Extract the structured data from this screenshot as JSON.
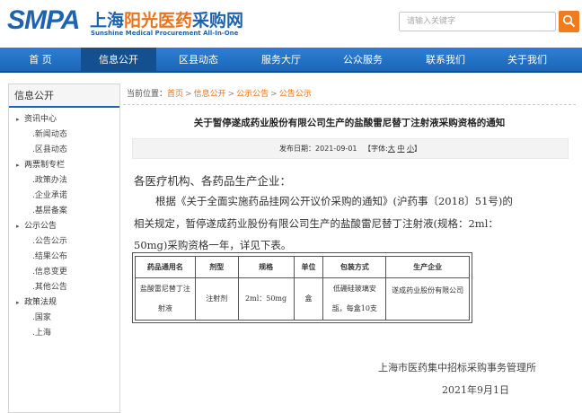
{
  "header": {
    "logo_smpa": "SMPA",
    "logo_cn_a": "上海",
    "logo_cn_b": "阳光医药",
    "logo_cn_c": "采购网",
    "logo_en": "Sunshine Medical Procurement All-In-One",
    "search_placeholder": "请输入关键字"
  },
  "nav": [
    {
      "label": "首 页",
      "active": false
    },
    {
      "label": "信息公开",
      "active": true
    },
    {
      "label": "区县动态",
      "active": false
    },
    {
      "label": "服务大厅",
      "active": false
    },
    {
      "label": "公众服务",
      "active": false
    },
    {
      "label": "联系我们",
      "active": false
    },
    {
      "label": "关于我们",
      "active": false
    }
  ],
  "sidebar": {
    "title": "信息公开",
    "groups": [
      {
        "label": "资讯中心",
        "items": [
          "新闻动态",
          "区县动态"
        ]
      },
      {
        "label": "两票制专栏",
        "items": [
          "政策办法",
          "企业承诺",
          "基层备案"
        ]
      },
      {
        "label": "公示公告",
        "items": [
          "公告公示",
          "结果公布",
          "信息变更",
          "其他公告"
        ]
      },
      {
        "label": "政策法规",
        "items": [
          "国家",
          "上海"
        ]
      }
    ]
  },
  "breadcrumb": {
    "prefix": "当前位置：",
    "items": [
      "首页",
      "信息公开",
      "公示公告",
      "公告公示"
    ],
    "sep": ">"
  },
  "article": {
    "title": "关于暂停遂成药业股份有限公司生产的盐酸雷尼替丁注射液采购资格的通知",
    "meta_date": "发布日期：2021-09-01",
    "meta_font_prefix": "【字体:",
    "meta_font_sizes": [
      "大",
      "中",
      "小"
    ],
    "meta_font_suffix": "】",
    "salutation": "各医疗机构、各药品生产企业：",
    "para_line1": "根据《关于全面实施药品挂网公开议价采购的通知》(沪药事〔2018〕51号)的",
    "para_line2": "相关规定，暂停遂成药业股份有限公司生产的盐酸雷尼替丁注射液(规格：2ml：",
    "para_line3": "50mg)采购资格一年，详见下表。",
    "table": {
      "headers": [
        "药品通用名",
        "剂型",
        "规格",
        "单位",
        "包装方式",
        "生产企业"
      ],
      "row": {
        "name_a": "盐酸雷尼替丁注",
        "name_b": "射液",
        "form": "注射剂",
        "spec": "2ml：50mg",
        "unit": "盒",
        "pack_a": "低硼硅玻璃安",
        "pack_b": "瓿，每盒10支",
        "maker": "遂成药业股份有限公司"
      }
    },
    "sign_org": "上海市医药集中招标采购事务管理所",
    "sign_date": "2021年9月1日"
  },
  "colors": {
    "brand_blue": "#1e63b0",
    "accent_orange": "#e8731a",
    "nav_active": "#14508f"
  }
}
